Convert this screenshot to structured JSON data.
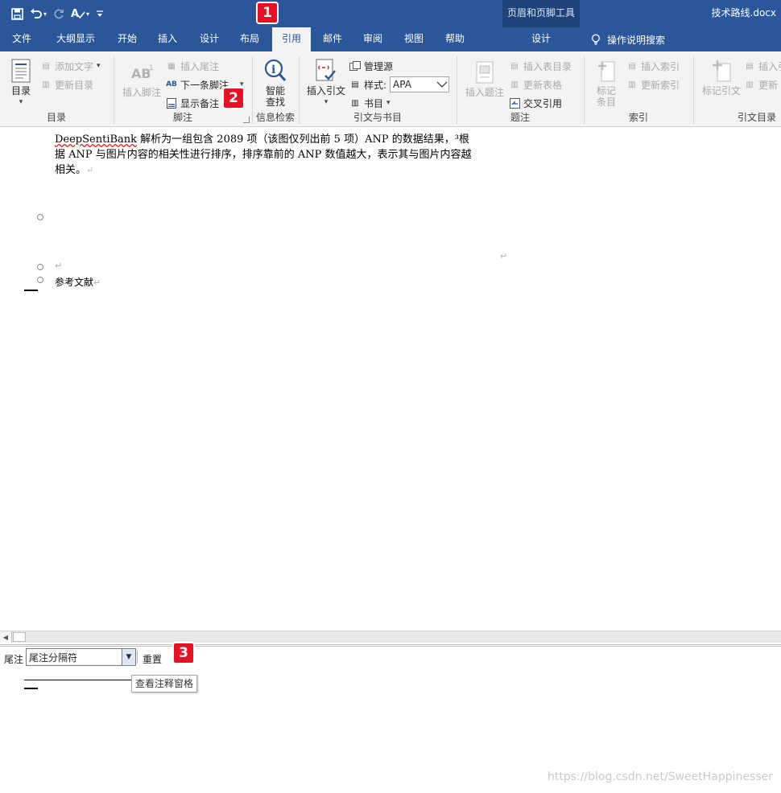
{
  "window": {
    "doc_title": "技术路线.docx",
    "context_tool_label": "页眉和页脚工具",
    "context_tab_label": "设计",
    "tell_me": "操作说明搜索"
  },
  "tabs": [
    {
      "label": "文件"
    },
    {
      "label": "大纲显示"
    },
    {
      "label": "开始"
    },
    {
      "label": "插入"
    },
    {
      "label": "设计"
    },
    {
      "label": "布局"
    },
    {
      "label": "引用",
      "active": true
    },
    {
      "label": "邮件"
    },
    {
      "label": "审阅"
    },
    {
      "label": "视图"
    },
    {
      "label": "帮助"
    }
  ],
  "ribbon": {
    "toc": {
      "group_label": "目录",
      "toc_btn": "目录",
      "add_text": "添加文字",
      "update_toc": "更新目录"
    },
    "footnotes": {
      "group_label": "脚注",
      "insert_footnote": "插入脚注",
      "insert_endnote": "插入尾注",
      "next_footnote": "下一条脚注",
      "show_notes": "显示备注"
    },
    "research": {
      "group_label": "信息检索",
      "smart_lookup_1": "智能",
      "smart_lookup_2": "查找"
    },
    "citations": {
      "group_label": "引文与书目",
      "insert_citation": "插入引文",
      "manage_sources": "管理源",
      "style_label": "样式:",
      "style_value": "APA",
      "bibliography": "书目"
    },
    "captions": {
      "group_label": "题注",
      "insert_caption": "插入题注",
      "insert_table_of_figures": "插入表目录",
      "update_table": "更新表格",
      "cross_reference": "交叉引用"
    },
    "index": {
      "group_label": "索引",
      "mark_entry_1": "标记",
      "mark_entry_2": "条目",
      "insert_index": "插入索引",
      "update_index": "更新索引"
    },
    "toa": {
      "group_label": "引文目录",
      "mark_citation": "标记引文",
      "insert_toa": "插入引",
      "update_toa": "更新"
    }
  },
  "document": {
    "para_lead": "DeepSentiBank",
    "para_rest": " 解析为一组包含 2089 项（该图仅列出前 5 项）ANP 的数据结果，³根据 ANP 与图片内容的相关性进行排序，排序靠前的 ANP 数值越大，表示其与图片内容越相关。",
    "para_mark": "↵",
    "empty_mark": "↵",
    "right_mark": "↵",
    "ref_heading": "参考文献",
    "ref_mark": "↵"
  },
  "notes_pane": {
    "label": "尾注",
    "dropdown_value": "尾注分隔符",
    "reset": "重置",
    "tooltip": "查看注释窗格"
  },
  "callouts": [
    "1",
    "2",
    "3"
  ],
  "watermark": "https://blog.csdn.net/SweetHappinesser"
}
